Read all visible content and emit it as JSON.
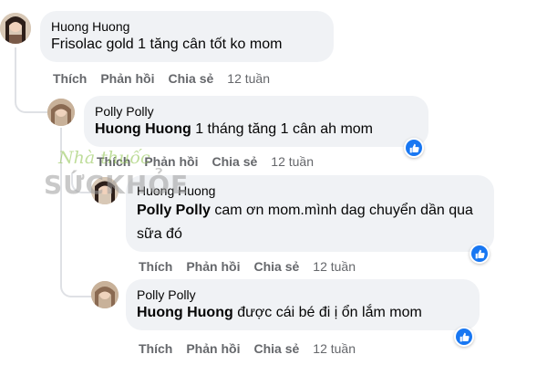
{
  "comments": [
    {
      "author": "Huong Huong",
      "mention": "",
      "text": "Frisolac gold 1 tăng cân tốt ko mom",
      "actions": [
        "Thích",
        "Phản hồi",
        "Chia sẻ"
      ],
      "time": "12 tuần"
    },
    {
      "author": "Polly Polly",
      "mention": "Huong Huong",
      "text": " 1 tháng tăng 1 cân ah mom",
      "actions": [
        "Thích",
        "Phản hồi",
        "Chia sẻ"
      ],
      "time": "12 tuần"
    },
    {
      "author": "Huong Huong",
      "mention": "Polly Polly",
      "text": " cam ơn mom.mình dag chuyển dần qua sữa đó",
      "actions": [
        "Thích",
        "Phản hồi",
        "Chia sẻ"
      ],
      "time": "12 tuần"
    },
    {
      "author": "Polly Polly",
      "mention": "Huong Huong",
      "text": " được cái bé đi ị ổn lắm mom",
      "actions": [
        "Thích",
        "Phản hồi",
        "Chia sẻ"
      ],
      "time": "12 tuần"
    }
  ],
  "watermark": {
    "top": "Nhà thuốc",
    "bottom": "SỨCKHỎE"
  },
  "colors": {
    "bubble": "#f0f2f5",
    "meta_text": "#65676b",
    "like_blue": "#1877f2",
    "watermark_green": "#8bc34a"
  },
  "icons": {
    "reaction": "thumbs-up-icon"
  }
}
